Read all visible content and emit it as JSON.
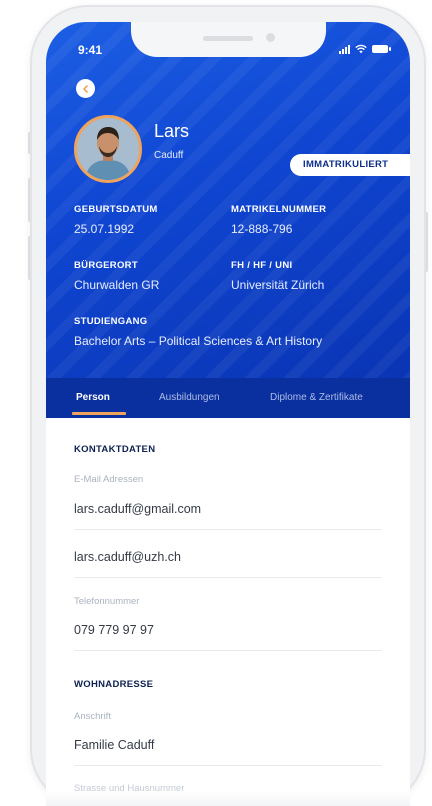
{
  "status_bar": {
    "time": "9:41"
  },
  "profile": {
    "first_name": "Lars",
    "last_name": "Caduff",
    "status_badge": "IMMATRIKULIERT"
  },
  "info": {
    "birthdate_label": "GEBURTSDATUM",
    "birthdate_value": "25.07.1992",
    "matriculation_label": "MATRIKELNUMMER",
    "matriculation_value": "12-888-796",
    "hometown_label": "BÜRGERORT",
    "hometown_value": "Churwalden GR",
    "university_label": "FH / HF / UNI",
    "university_value": "Universität Zürich",
    "program_label": "STUDIENGANG",
    "program_value": "Bachelor Arts – Political Sciences & Art History"
  },
  "tabs": [
    {
      "label": "Person",
      "active": true
    },
    {
      "label": "Ausbildungen",
      "active": false
    },
    {
      "label": "Diplome & Zertifikate",
      "active": false
    }
  ],
  "contact": {
    "section_title": "KONTAKTDATEN",
    "email_label": "E-Mail Adressen",
    "emails": [
      "lars.caduff@gmail.com",
      "lars.caduff@uzh.ch"
    ],
    "phone_label": "Telefonnummer",
    "phone_value": "079 779 97 97"
  },
  "address": {
    "section_title": "WOHNADRESSE",
    "street_label": "Anschrift",
    "street_value": "Familie Caduff",
    "partial_label": "Strasse und Hausnummer"
  },
  "colors": {
    "primary": "#0f45d1",
    "tab_bar": "#0a2f9f",
    "accent": "#f0a45b",
    "title_dark": "#0d2150"
  },
  "icons": {
    "back": "chevron-left-icon",
    "signal": "signal-icon",
    "wifi": "wifi-icon",
    "battery": "battery-icon"
  }
}
